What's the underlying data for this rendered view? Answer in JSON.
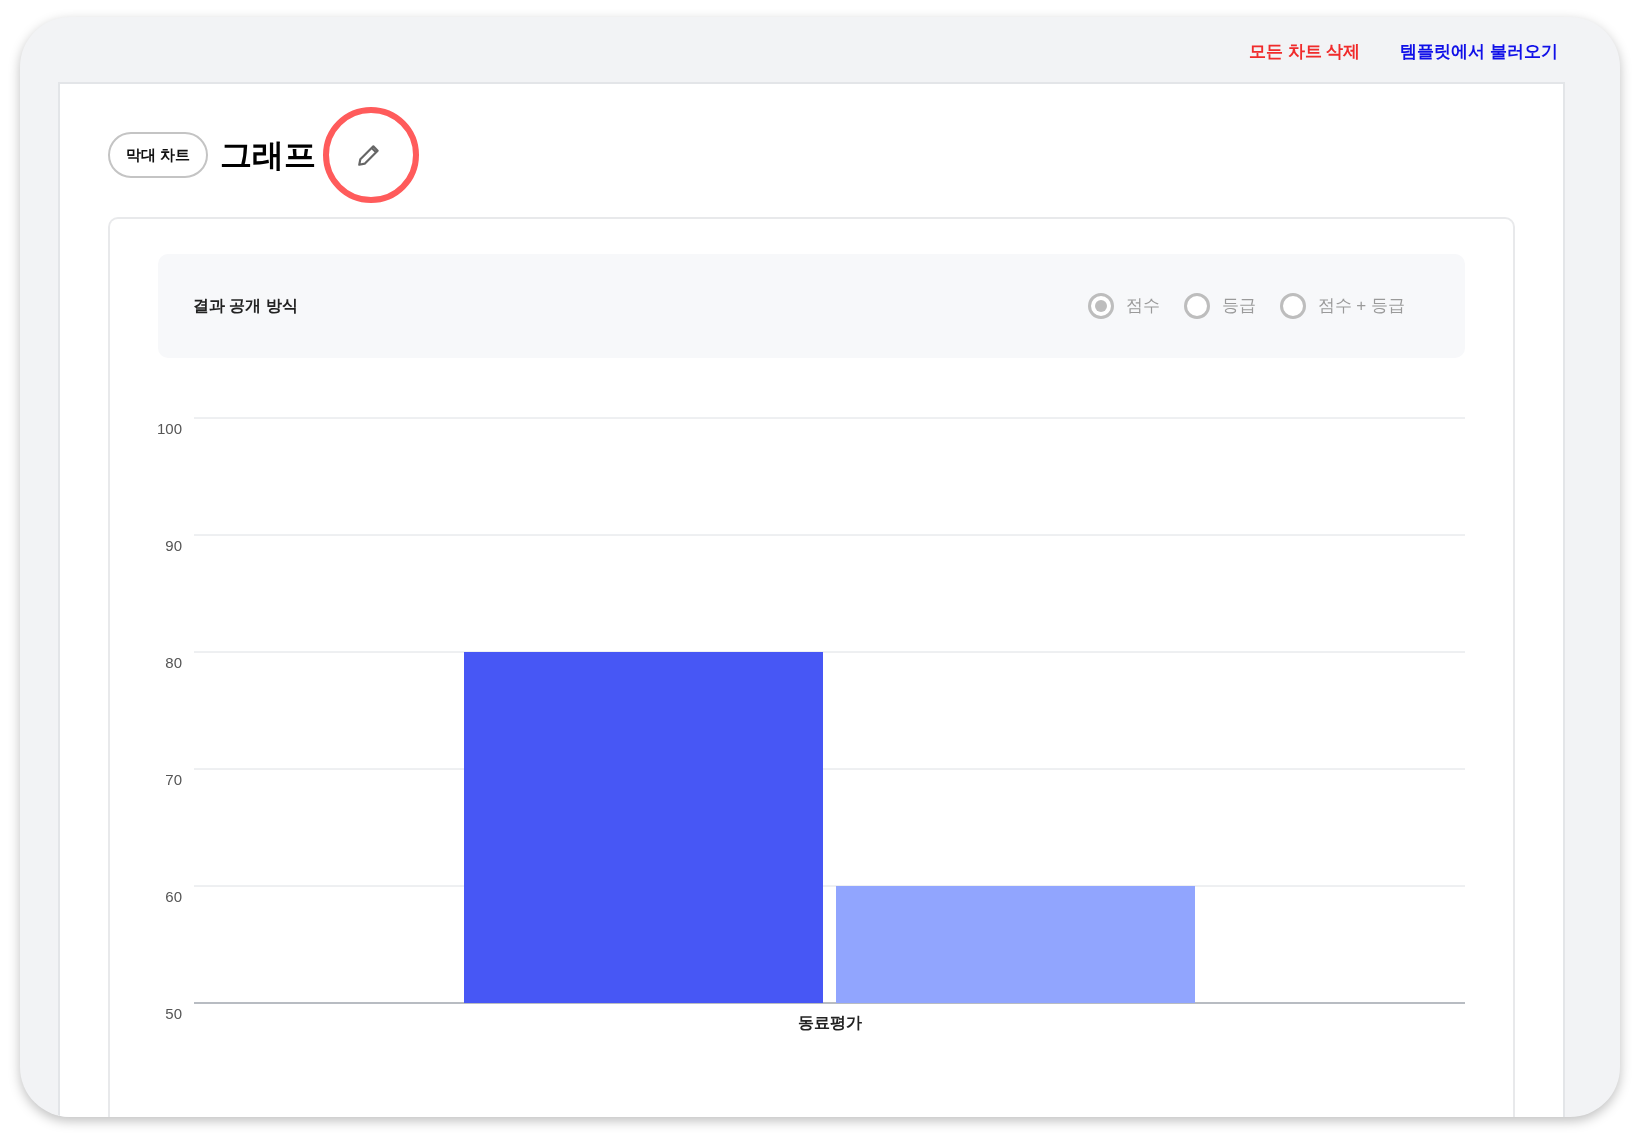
{
  "header_links": [
    {
      "label": "모든 차트 삭제",
      "kind": "danger"
    },
    {
      "label": "템플릿에서 불러오기",
      "kind": "primary"
    }
  ],
  "chart_header": {
    "type_badge": "막대 차트",
    "title": "그래프"
  },
  "result_visibility": {
    "label": "결과 공개 방식",
    "options": [
      {
        "label": "점수",
        "selected": true
      },
      {
        "label": "등급",
        "selected": false
      },
      {
        "label": "점수 + 등급",
        "selected": false
      }
    ]
  },
  "chart": {
    "chart_data": {
      "type": "bar",
      "categories": [
        "동료평가"
      ],
      "series": [
        {
          "color": "#4757f5",
          "values": [
            80
          ]
        },
        {
          "color": "#91a5fe",
          "values": [
            60
          ]
        }
      ],
      "ylim": [
        50,
        100
      ],
      "grid": true,
      "yticks": [
        50,
        60,
        70,
        80,
        90,
        100
      ]
    }
  }
}
